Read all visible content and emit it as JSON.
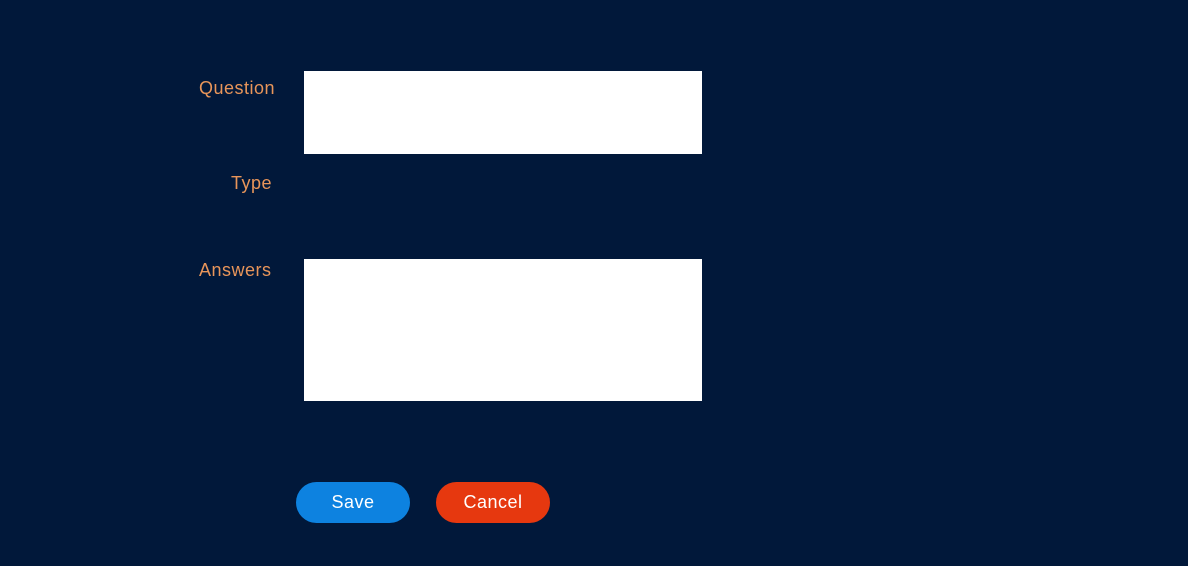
{
  "form": {
    "question_label": "Question",
    "type_label": "Type",
    "answers_label": "Answers",
    "question_value": "",
    "answers_value": ""
  },
  "actions": {
    "save_label": "Save",
    "cancel_label": "Cancel"
  },
  "colors": {
    "background": "#01183a",
    "label": "#e8955a",
    "save_button": "#0d82e0",
    "cancel_button": "#e6380f"
  }
}
